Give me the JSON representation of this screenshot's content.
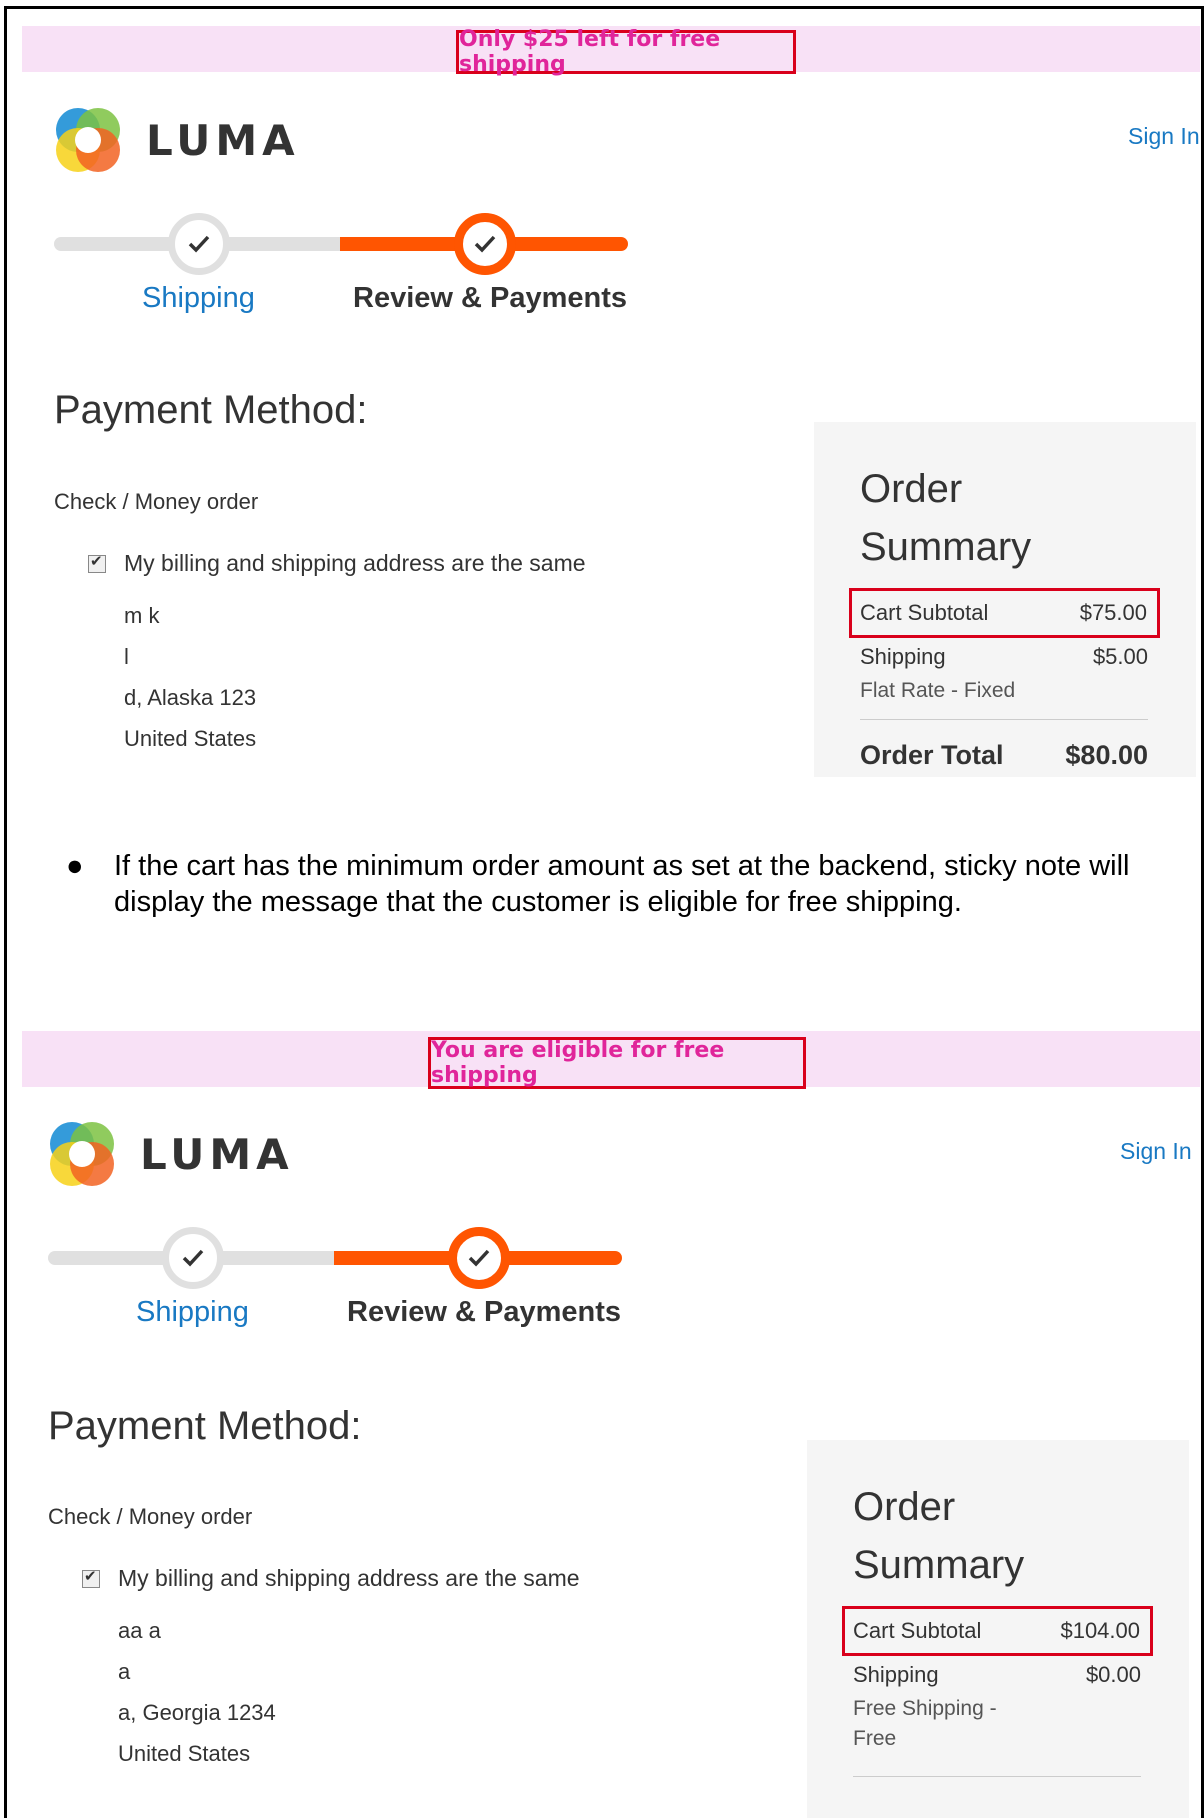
{
  "screens": [
    {
      "promo_message": "Only $25 left for free shipping",
      "logo_text": "LUMA",
      "sign_in": "Sign In",
      "steps": [
        "Shipping",
        "Review & Payments"
      ],
      "payment_title": "Payment Method:",
      "payment_method": "Check / Money order",
      "same_address_label": "My billing and shipping address are the same",
      "address_lines": [
        "m k",
        "l",
        "d, Alaska 123",
        "United States"
      ],
      "summary": {
        "title_line1": "Order",
        "title_line2": "Summary",
        "cart_subtotal_label": "Cart Subtotal",
        "cart_subtotal_value": "$75.00",
        "shipping_label": "Shipping",
        "shipping_value": "$5.00",
        "shipping_method": "Flat Rate - Fixed",
        "order_total_label": "Order Total",
        "order_total_value": "$80.00"
      }
    },
    {
      "promo_message": "You are eligible for free shipping",
      "logo_text": "LUMA",
      "sign_in": "Sign In",
      "steps": [
        "Shipping",
        "Review & Payments"
      ],
      "payment_title": "Payment Method:",
      "payment_method": "Check / Money order",
      "same_address_label": "My billing and shipping address are the same",
      "address_lines": [
        "aa a",
        "a",
        "a, Georgia 1234",
        "United States"
      ],
      "summary": {
        "title_line1": "Order",
        "title_line2": "Summary",
        "cart_subtotal_label": "Cart Subtotal",
        "cart_subtotal_value": "$104.00",
        "shipping_label": "Shipping",
        "shipping_value": "$0.00",
        "shipping_method": "Free Shipping - Free"
      }
    }
  ],
  "note_bullet": "●",
  "note_text": "If the cart has the minimum order amount as set at the backend, sticky note will display the message that the customer is eligible for free shipping.",
  "colors": {
    "promo_bg": "#f8e1f6",
    "promo_text": "#e0259a",
    "highlight_border": "#d9001b",
    "progress_active": "#ff5501",
    "link": "#1979c3"
  }
}
